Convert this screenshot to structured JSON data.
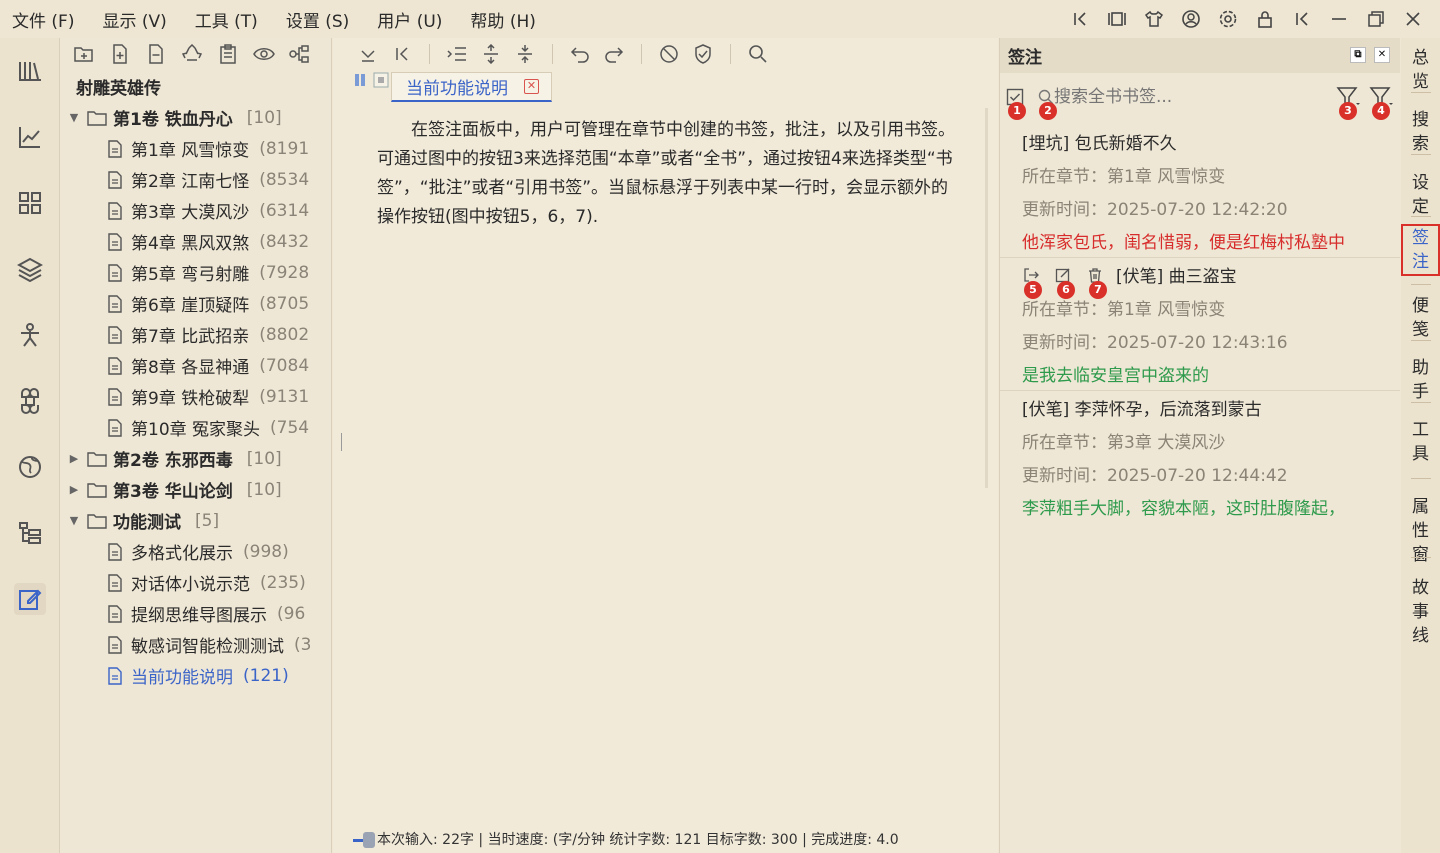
{
  "menu": [
    "文件 (F)",
    "显示 (V)",
    "工具 (T)",
    "设置 (S)",
    "用户 (U)",
    "帮助 (H)"
  ],
  "top_icons": [
    "collapse-left-icon",
    "layout-icon",
    "theme-shirt-icon",
    "user-circle-icon",
    "gear-icon",
    "lock-icon",
    "collapse-icon",
    "minimize-icon",
    "restore-icon",
    "close-icon"
  ],
  "left_rail": [
    "library-icon",
    "stats-icon",
    "apps-grid-icon",
    "layers-icon",
    "character-icon",
    "command-icon",
    "globe-icon",
    "outline-tree-icon",
    "edit-note-icon"
  ],
  "tree": {
    "book_title": "射雕英雄传",
    "rows": [
      {
        "type": "vol",
        "expanded": true,
        "label": "第1卷 铁血丹心",
        "count": "[10]"
      },
      {
        "type": "chap",
        "label": "第1章 风雪惊变",
        "count": "(8191"
      },
      {
        "type": "chap",
        "label": "第2章 江南七怪",
        "count": "(8534"
      },
      {
        "type": "chap",
        "label": "第3章 大漠风沙",
        "count": "(6314"
      },
      {
        "type": "chap",
        "label": "第4章 黑风双煞",
        "count": "(8432"
      },
      {
        "type": "chap",
        "label": "第5章 弯弓射雕",
        "count": "(7928"
      },
      {
        "type": "chap",
        "label": "第6章 崖顶疑阵",
        "count": "(8705"
      },
      {
        "type": "chap",
        "label": "第7章 比武招亲",
        "count": "(8802"
      },
      {
        "type": "chap",
        "label": "第8章 各显神通",
        "count": "(7084"
      },
      {
        "type": "chap",
        "label": "第9章 铁枪破犁",
        "count": "(9131"
      },
      {
        "type": "chap",
        "label": "第10章 冤家聚头",
        "count": "(754"
      },
      {
        "type": "vol",
        "expanded": false,
        "label": "第2卷 东邪西毒",
        "count": "[10]"
      },
      {
        "type": "vol",
        "expanded": false,
        "label": "第3卷 华山论剑",
        "count": "[10]"
      },
      {
        "type": "vol",
        "expanded": true,
        "label": "功能测试",
        "count": "[5]"
      },
      {
        "type": "chap",
        "label": "多格式化展示",
        "count": "(998)"
      },
      {
        "type": "chap",
        "label": "对话体小说示范",
        "count": "(235)"
      },
      {
        "type": "chap",
        "label": "提纲思维导图展示",
        "count": "(96"
      },
      {
        "type": "chap",
        "label": "敏感词智能检测测试",
        "count": "(3"
      },
      {
        "type": "chap",
        "label": "当前功能说明",
        "count": "(121)",
        "selected": true
      }
    ]
  },
  "editor": {
    "tab_label": "当前功能说明",
    "body": "在签注面板中，用户可管理在章节中创建的书签，批注，以及引用书签。可通过图中的按钮3来选择范围“本章”或者“全书”，通过按钮4来选择类型“书签”，“批注”或者“引用书签”。当鼠标悬浮于列表中某一行时，会显示额外的操作按钮(图中按钮5，6，7)."
  },
  "status": {
    "text": "本次输入: 22字 | 当时速度: (字/分钟 统计字数: 121 目标字数: 300 | 完成进度: 4.0"
  },
  "annotation_panel": {
    "title": "签注",
    "search_placeholder": "搜索全书书签...",
    "badges": [
      "1",
      "2",
      "3",
      "4"
    ],
    "action_badges": [
      "5",
      "6",
      "7"
    ],
    "items": [
      {
        "title": "[埋坑] 包氏新婚不久",
        "chapter": "所在章节：第1章 风雪惊变",
        "time": "更新时间：2025-07-20 12:42:20",
        "excerpt": "他浑家包氏，闺名惜弱，便是红梅村私塾中",
        "excerpt_color": "red"
      },
      {
        "title": "[伏笔] 曲三盗宝",
        "chapter": "所在章节：第1章 风雪惊变",
        "time": "更新时间：2025-07-20 12:43:16",
        "excerpt": "是我去临安皇宫中盗来的",
        "excerpt_color": "green",
        "hover": true
      },
      {
        "title": "[伏笔] 李萍怀孕，后流落到蒙古",
        "chapter": "所在章节：第3章 大漠风沙",
        "time": "更新时间：2025-07-20 12:44:42",
        "excerpt": "李萍粗手大脚，容貌本陋，这时肚腹隆起，",
        "excerpt_color": "green"
      }
    ]
  },
  "right_rail": [
    "总览",
    "搜索",
    "设定",
    "签注",
    "便笺",
    "助手",
    "工具",
    "属性窗",
    "故事线"
  ],
  "right_rail_active": "签注",
  "colors": {
    "accent": "#3b64c8",
    "badge": "#d9302a",
    "red_text": "#d72c2c",
    "green_text": "#2d9a4c"
  }
}
